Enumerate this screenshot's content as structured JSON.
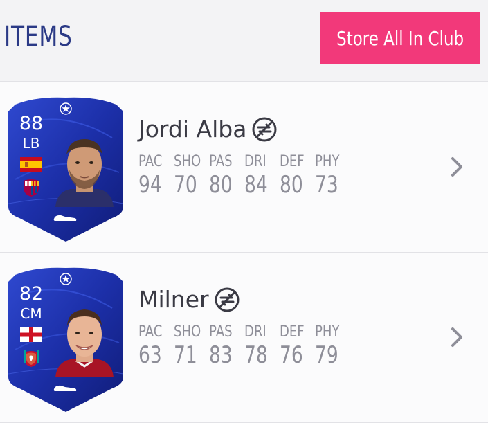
{
  "header": {
    "title": "ITEMS",
    "store_button_label": "Store All In Club"
  },
  "colors": {
    "accent": "#f2397a",
    "title": "#2b3a86",
    "card_blue": "#1a2fa3",
    "stat_grey": "#8e8e98"
  },
  "items": [
    {
      "rating": "88",
      "position": "LB",
      "name": "Jordi Alba",
      "nation_flag": "spain-flag",
      "club_crest": "fc-barcelona-crest",
      "untradeable": true,
      "stat_labels": [
        "PAC",
        "SHO",
        "PAS",
        "DRI",
        "DEF",
        "PHY"
      ],
      "stat_values": [
        "94",
        "70",
        "80",
        "84",
        "80",
        "73"
      ]
    },
    {
      "rating": "82",
      "position": "CM",
      "name": "Milner",
      "nation_flag": "england-flag",
      "club_crest": "liverpool-crest",
      "untradeable": true,
      "stat_labels": [
        "PAC",
        "SHO",
        "PAS",
        "DRI",
        "DEF",
        "PHY"
      ],
      "stat_values": [
        "63",
        "71",
        "83",
        "78",
        "76",
        "79"
      ]
    }
  ]
}
